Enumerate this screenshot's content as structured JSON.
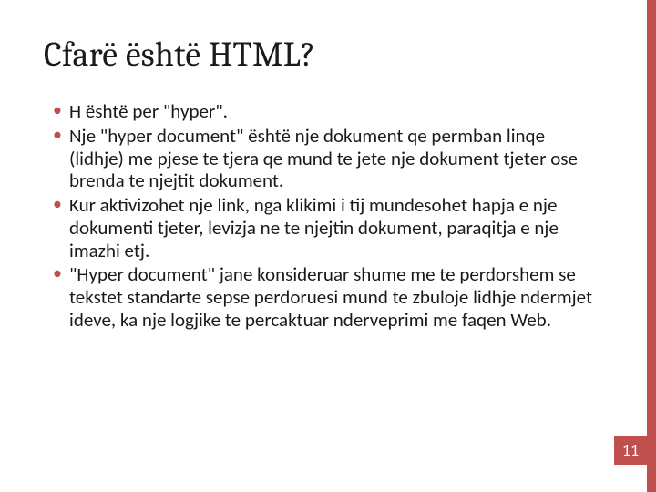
{
  "slide": {
    "title": "Cfarë është  HTML?",
    "bullets": [
      "H është  per \"hyper\".",
      "Nje \"hyper document\" është  nje dokument qe permban linqe (lidhje) me pjese te tjera qe mund te jete nje dokument tjeter ose brenda te njejtit dokument.",
      "Kur aktivizohet nje link, nga klikimi i tij mundesohet hapja e nje dokumenti tjeter, levizja ne te njejtin dokument, paraqitja e nje imazhi etj.",
      "\"Hyper document\" jane konsideruar shume me te perdorshem se tekstet standarte sepse perdoruesi mund te zbuloje lidhje ndermjet ideve, ka nje logjike te percaktuar nderveprimi me faqen Web."
    ],
    "page_number": "11"
  },
  "colors": {
    "accent": "#c0504d"
  }
}
